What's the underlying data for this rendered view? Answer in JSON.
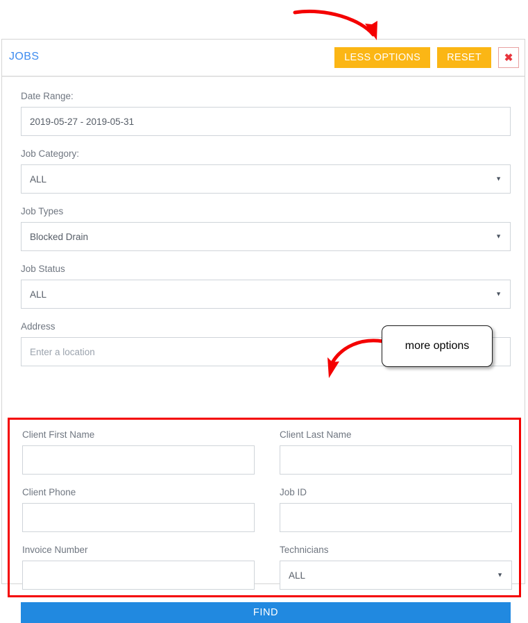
{
  "header": {
    "title": "JOBS",
    "less_options_label": "LESS OPTIONS",
    "reset_label": "RESET",
    "close_label": "✖"
  },
  "form": {
    "date_range": {
      "label": "Date Range:",
      "value": "2019-05-27 - 2019-05-31"
    },
    "job_category": {
      "label": "Job Category:",
      "value": "ALL",
      "caret": "▼"
    },
    "job_types": {
      "label": "Job Types",
      "value": "Blocked Drain",
      "caret": "▼"
    },
    "job_status": {
      "label": "Job Status",
      "value": "ALL",
      "caret": "▼"
    },
    "address": {
      "label": "Address",
      "value": "",
      "placeholder": "Enter a location"
    }
  },
  "more_options": {
    "client_first_name": {
      "label": "Client First Name",
      "value": "",
      "placeholder": ""
    },
    "client_last_name": {
      "label": "Client Last Name",
      "value": "",
      "placeholder": ""
    },
    "client_phone": {
      "label": "Client Phone",
      "value": "",
      "placeholder": ""
    },
    "job_id": {
      "label": "Job ID",
      "value": "",
      "placeholder": ""
    },
    "invoice_number": {
      "label": "Invoice Number",
      "value": "",
      "placeholder": ""
    },
    "technicians": {
      "label": "Technicians",
      "value": "ALL",
      "caret": "▼"
    }
  },
  "find_button": {
    "label": "FIND"
  },
  "annotations": {
    "callout_text": "more options",
    "arrow_color": "#f40000",
    "highlight_color": "#f40000"
  },
  "colors": {
    "accent_blue": "#3d8bef",
    "button_amber": "#fbb615",
    "find_blue": "#2189e0",
    "close_red": "#e8343c",
    "label_gray": "#6f7680"
  }
}
